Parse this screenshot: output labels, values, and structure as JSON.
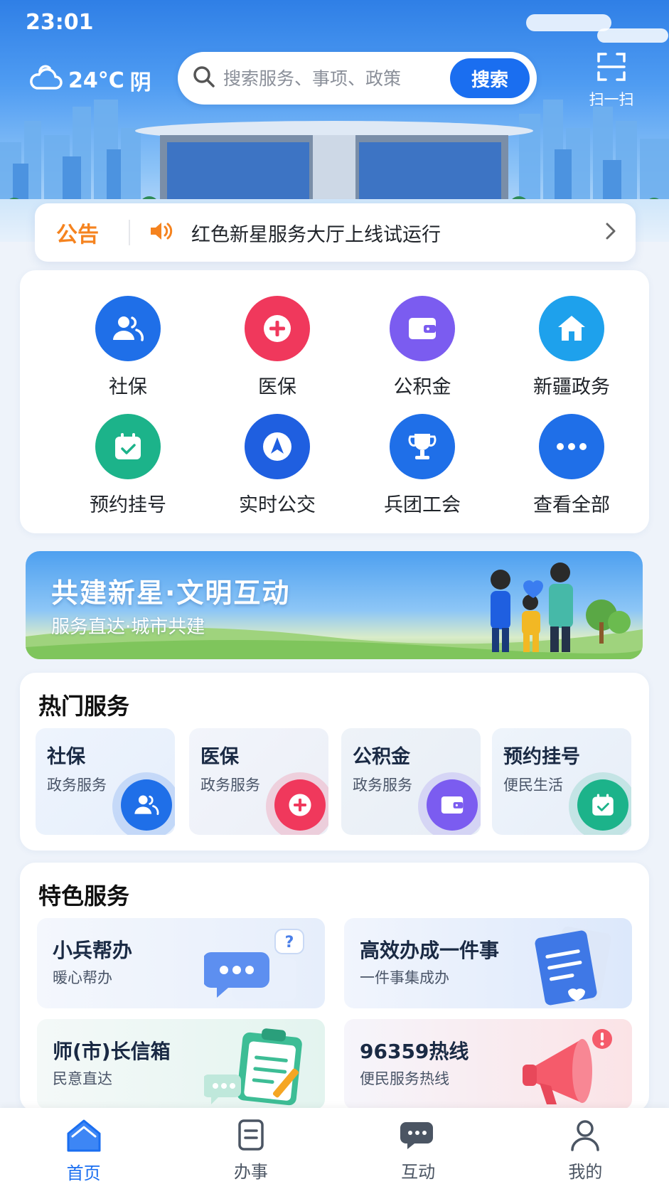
{
  "status_bar": {
    "time": "23:01"
  },
  "header": {
    "weather": {
      "temp": "24°C",
      "condition": "阴",
      "icon": "cloud-icon"
    },
    "search": {
      "placeholder": "搜索服务、事项、政策",
      "button_label": "搜索"
    },
    "scan": {
      "label": "扫一扫",
      "icon": "scan-icon"
    }
  },
  "notice": {
    "tag": "公告",
    "text": "红色新星服务大厅上线试运行"
  },
  "quick_services": [
    {
      "label": "社保",
      "icon": "people-icon",
      "color": "#1f6fe8"
    },
    {
      "label": "医保",
      "icon": "plus-icon",
      "color": "#f0385c"
    },
    {
      "label": "公积金",
      "icon": "wallet-icon",
      "color": "#7b5cf0"
    },
    {
      "label": "新疆政务",
      "icon": "home-icon",
      "color": "#1ea1ec"
    },
    {
      "label": "预约挂号",
      "icon": "calendar-icon",
      "color": "#1cb38a"
    },
    {
      "label": "实时公交",
      "icon": "navigation-icon",
      "color": "#1f5fe0"
    },
    {
      "label": "兵团工会",
      "icon": "trophy-icon",
      "color": "#1f6fe8"
    },
    {
      "label": "查看全部",
      "icon": "more-icon",
      "color": "#1f6fe8"
    }
  ],
  "banner": {
    "title": "共建新星·文明互动",
    "subtitle": "服务直达·城市共建"
  },
  "hot_services": {
    "title": "热门服务",
    "items": [
      {
        "title": "社保",
        "subtitle": "政务服务",
        "icon": "people-icon",
        "color": "#1f6fe8"
      },
      {
        "title": "医保",
        "subtitle": "政务服务",
        "icon": "plus-icon",
        "color": "#f0385c"
      },
      {
        "title": "公积金",
        "subtitle": "政务服务",
        "icon": "wallet-icon",
        "color": "#7b5cf0"
      },
      {
        "title": "预约挂号",
        "subtitle": "便民生活",
        "icon": "calendar-icon",
        "color": "#1cb38a"
      }
    ]
  },
  "featured_services": {
    "title": "特色服务",
    "items": [
      {
        "title": "小兵帮办",
        "subtitle": "暖心帮办",
        "icon": "chat-bubble-icon"
      },
      {
        "title": "高效办成一件事",
        "subtitle": "一件事集成办",
        "icon": "document-icon"
      },
      {
        "title": "师(市)长信箱",
        "subtitle": "民意直达",
        "icon": "clipboard-icon"
      },
      {
        "title": "96359热线",
        "subtitle": "便民服务热线",
        "icon": "megaphone-icon"
      }
    ]
  },
  "bottom_nav": [
    {
      "label": "首页",
      "icon": "home-icon",
      "active": true
    },
    {
      "label": "办事",
      "icon": "document-icon",
      "active": false
    },
    {
      "label": "互动",
      "icon": "chat-icon",
      "active": false
    },
    {
      "label": "我的",
      "icon": "user-icon",
      "active": false
    }
  ]
}
